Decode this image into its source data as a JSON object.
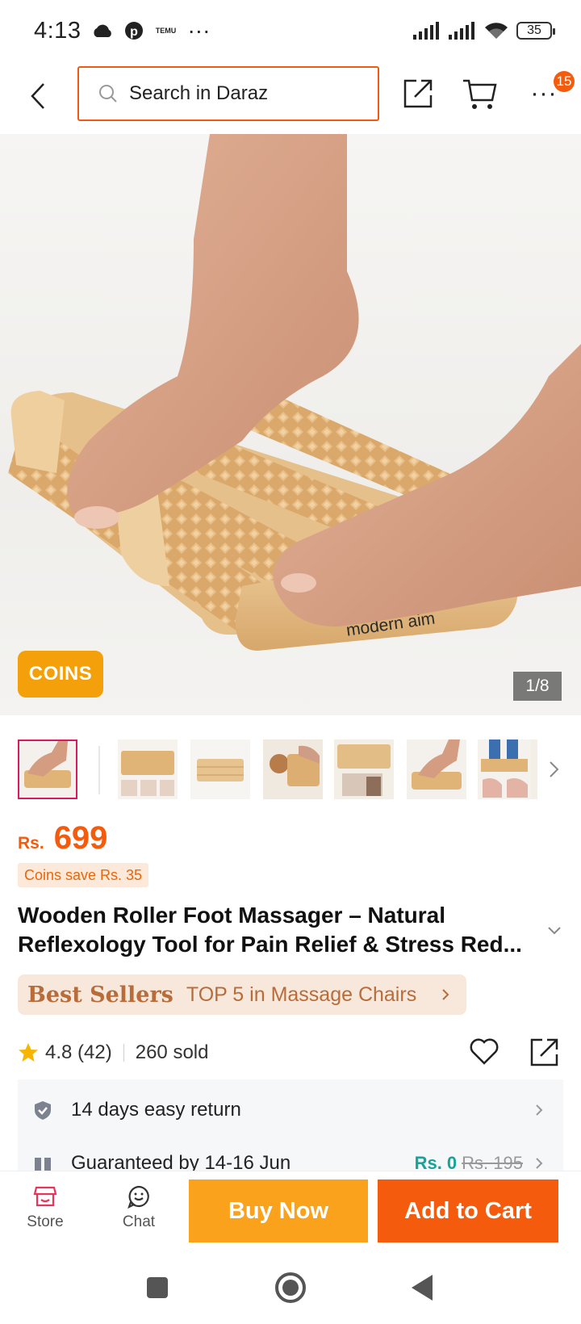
{
  "status_bar": {
    "time": "4:13",
    "temu_icon_text": "TEMU",
    "more": "···",
    "battery": "35",
    "icons": [
      "cloud-icon",
      "pinterest-icon",
      "temu-icon",
      "signal-icon",
      "signal-icon",
      "wifi-icon",
      "battery-icon"
    ]
  },
  "top_nav": {
    "search_placeholder": "Search in Daraz",
    "more": "···",
    "badge_count": "15",
    "accent_color": "#f05a14"
  },
  "gallery": {
    "coins_label": "COINS",
    "counter": "1/8",
    "brand_mark": "modern aim",
    "thumbnail_count": 7
  },
  "product": {
    "currency": "Rs.",
    "price": "699",
    "coins_save": "Coins save Rs. 35",
    "title": "Wooden Roller Foot Massager – Natural Reflexology Tool for Pain Relief & Stress Red...",
    "bestseller_label": "Best Sellers",
    "bestseller_rank": "TOP 5 in Massage Chairs",
    "rating": "4.8",
    "reviews": "(42)",
    "sold": "260 sold"
  },
  "services": {
    "return_label": "14 days easy return",
    "delivery_label": "Guaranteed by 14-16 Jun",
    "delivery_fee": "Rs. 0",
    "delivery_fee_old": "Rs. 195"
  },
  "bottom_bar": {
    "store_label": "Store",
    "chat_label": "Chat",
    "buy_now_label": "Buy Now",
    "add_to_cart_label": "Add to Cart",
    "buy_color": "#faa21b",
    "cart_color": "#f45b0c"
  }
}
